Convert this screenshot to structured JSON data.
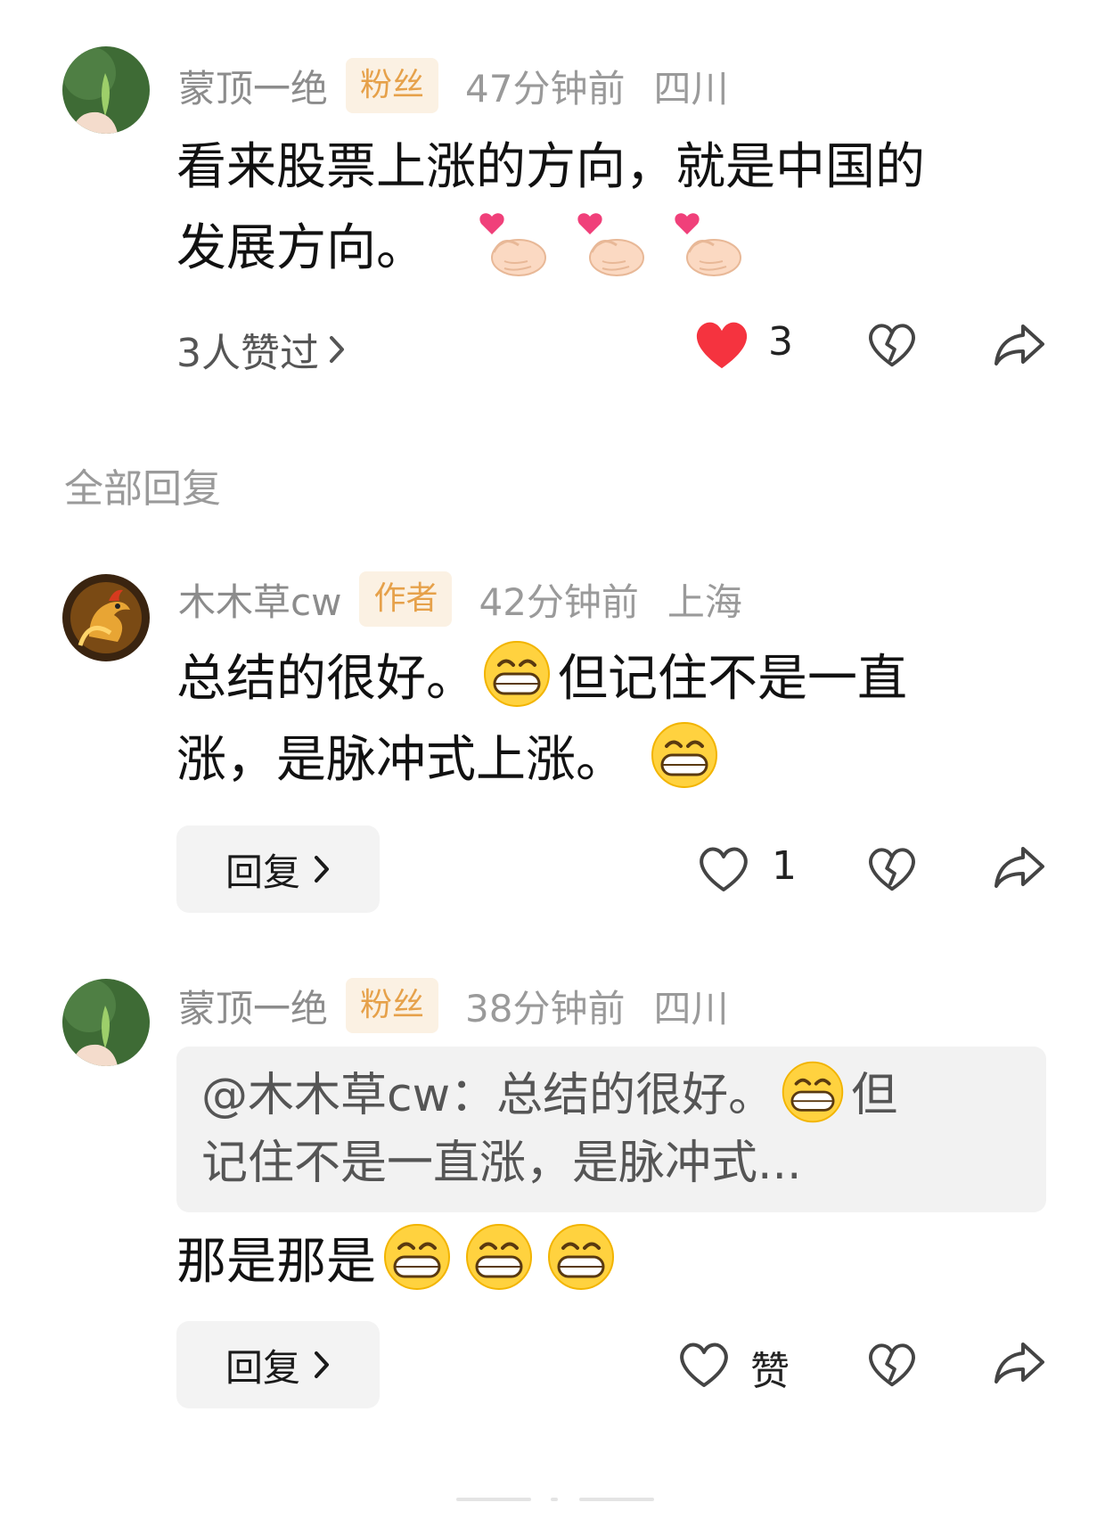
{
  "comments": [
    {
      "user": "蒙顶一绝",
      "badge": "粉丝",
      "time": "47分钟前",
      "location": "四川",
      "text_line1": "看来股票上涨的方向，就是中国的",
      "text_line2": "发展方向。",
      "emojis": [
        "finger-heart-icon",
        "finger-heart-icon",
        "finger-heart-icon"
      ],
      "likers_text": "3人赞过",
      "like_count": "3",
      "liked": true
    }
  ],
  "replies_section_title": "全部回复",
  "replies": [
    {
      "user": "木木草cw",
      "badge": "作者",
      "time": "42分钟前",
      "location": "上海",
      "text_part1": "总结的很好。",
      "text_part2": "但记住不是一直",
      "text_part3": "涨，是脉冲式上涨。",
      "reply_label": "回复",
      "like_count": "1"
    },
    {
      "user": "蒙顶一绝",
      "badge": "粉丝",
      "time": "38分钟前",
      "location": "四川",
      "quote_part1": "@木木草cw：总结的很好。",
      "quote_part2": "但",
      "quote_part3": "记住不是一直涨，是脉冲式...",
      "text": "那是那是",
      "reply_label": "回复",
      "like_label": "赞"
    }
  ],
  "colors": {
    "accent_red": "#f5333f",
    "badge_bg": "#fbf1e3",
    "badge_text": "#e6a14a",
    "meta_gray": "#9a9a9a"
  }
}
